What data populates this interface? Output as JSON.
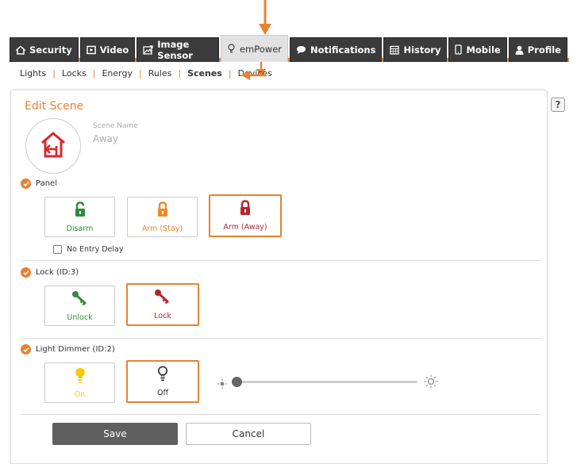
{
  "colors": {
    "accent": "#e8822e",
    "green": "#2e8b3a",
    "red": "#b5262c",
    "yellow": "#f2cc0c",
    "tab_dark": "#3b3b3b"
  },
  "tabs": [
    {
      "label": "Security",
      "icon": "home-icon"
    },
    {
      "label": "Video",
      "icon": "video-icon"
    },
    {
      "label": "Image Sensor",
      "icon": "image-sensor-icon"
    },
    {
      "label": "emPower",
      "icon": "lightbulb-icon",
      "active": true
    },
    {
      "label": "Notifications",
      "icon": "speech-bubble-icon"
    },
    {
      "label": "History",
      "icon": "calendar-icon"
    },
    {
      "label": "Mobile",
      "icon": "mobile-icon"
    },
    {
      "label": "Profile",
      "icon": "user-icon"
    }
  ],
  "subnav": [
    {
      "label": "Lights"
    },
    {
      "label": "Locks"
    },
    {
      "label": "Energy"
    },
    {
      "label": "Rules"
    },
    {
      "label": "Scenes",
      "active": true
    },
    {
      "label": "Devices"
    }
  ],
  "help_label": "?",
  "edit_scene": {
    "title": "Edit Scene",
    "scene_name_label": "Scene Name",
    "scene_name_value": "Away"
  },
  "panel_section": {
    "title": "Panel",
    "options": [
      {
        "label": "Disarm",
        "color": "#2e8b3a"
      },
      {
        "label": "Arm (Stay)",
        "color": "#e8822e"
      },
      {
        "label": "Arm (Away)",
        "color": "#b5262c",
        "selected": true
      }
    ],
    "no_entry_delay_label": "No Entry Delay"
  },
  "lock_section": {
    "title": "Lock (ID:3)",
    "options": [
      {
        "label": "Unlock",
        "color": "#2e8b3a"
      },
      {
        "label": "Lock",
        "color": "#b5262c",
        "selected": true
      }
    ]
  },
  "dimmer_section": {
    "title": "Light Dimmer (ID:2)",
    "options": [
      {
        "label": "On",
        "color": "#f2cc0c"
      },
      {
        "label": "Off",
        "color": "#333333",
        "selected": true
      }
    ],
    "slider_level": 0
  },
  "buttons": {
    "save": "Save",
    "cancel": "Cancel"
  }
}
